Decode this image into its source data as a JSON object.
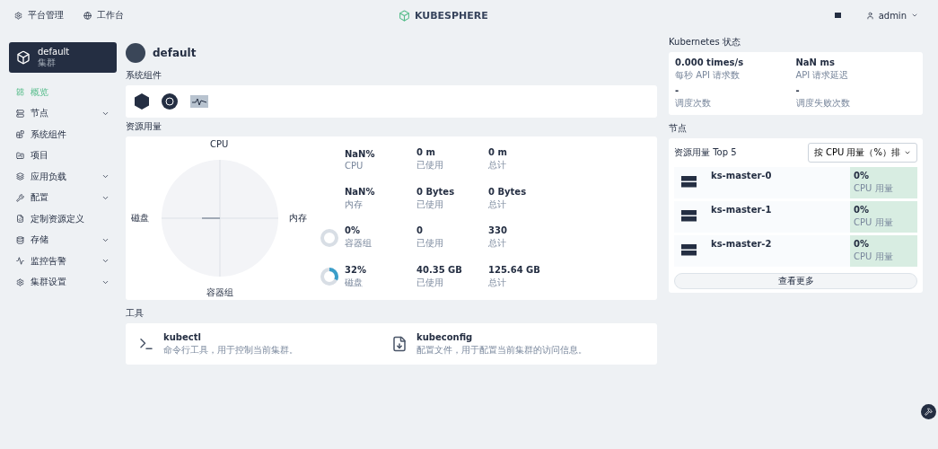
{
  "topbar": {
    "links": [
      {
        "label": "平台管理"
      },
      {
        "label": "工作台"
      }
    ],
    "logo": "KUBESPHERE",
    "user": "admin"
  },
  "cluster": {
    "name": "default",
    "subtitle": "集群"
  },
  "page_title": "default",
  "sidebar": {
    "items": [
      {
        "label": "概览",
        "selected": true,
        "expandable": false
      },
      {
        "label": "节点",
        "selected": false,
        "expandable": true
      },
      {
        "label": "系统组件",
        "selected": false,
        "expandable": false
      },
      {
        "label": "项目",
        "selected": false,
        "expandable": false
      },
      {
        "label": "应用负载",
        "selected": false,
        "expandable": true
      },
      {
        "label": "配置",
        "selected": false,
        "expandable": true
      },
      {
        "label": "定制资源定义",
        "selected": false,
        "expandable": false
      },
      {
        "label": "存储",
        "selected": false,
        "expandable": true
      },
      {
        "label": "监控告警",
        "selected": false,
        "expandable": true
      },
      {
        "label": "集群设置",
        "selected": false,
        "expandable": true
      }
    ]
  },
  "system_components": {
    "title": "系统组件"
  },
  "resource_usage": {
    "title": "资源用量",
    "radar_labels": [
      "CPU",
      "内存",
      "容器组",
      "磁盘"
    ],
    "rows": [
      {
        "value": "NaN%",
        "label": "CPU",
        "used": "0 m",
        "used_label": "已使用",
        "total": "0 m",
        "total_label": "总计"
      },
      {
        "value": "NaN%",
        "label": "内存",
        "used": "0 Bytes",
        "used_label": "已使用",
        "total": "0 Bytes",
        "total_label": "总计"
      },
      {
        "value": "0%",
        "label": "容器组",
        "level": 0,
        "used": "0",
        "used_label": "已使用",
        "total": "330",
        "total_label": "总计"
      },
      {
        "value": "32%",
        "label": "磁盘",
        "level": 0.32,
        "used": "40.35 GB",
        "used_label": "已使用",
        "total": "125.64 GB",
        "total_label": "总计"
      }
    ]
  },
  "tools": {
    "title": "工具",
    "items": [
      {
        "kind": "terminal",
        "name": "kubectl",
        "description": "命令行工具，用于控制当前集群。"
      },
      {
        "kind": "file",
        "name": "kubeconfig",
        "description": "配置文件，用于配置当前集群的访问信息。"
      }
    ]
  },
  "k8s_status": {
    "title": "Kubernetes 状态",
    "stats": [
      {
        "value": "0.000 times/s",
        "label": "每秒 API 请求数"
      },
      {
        "value": "NaN ms",
        "label": "API 请求延迟"
      },
      {
        "value": "-",
        "label": "调度次数"
      },
      {
        "value": "-",
        "label": "调度失败次数"
      }
    ]
  },
  "nodes": {
    "title": "节点",
    "heading": "资源用量 Top 5",
    "sort": "按 CPU 用量（%）排",
    "rows": [
      {
        "name": "ks-master-0",
        "value": "0%",
        "label": "CPU 用量"
      },
      {
        "name": "ks-master-1",
        "value": "0%",
        "label": "CPU 用量"
      },
      {
        "name": "ks-master-2",
        "value": "0%",
        "label": "CPU 用量"
      }
    ],
    "more": "查看更多"
  }
}
